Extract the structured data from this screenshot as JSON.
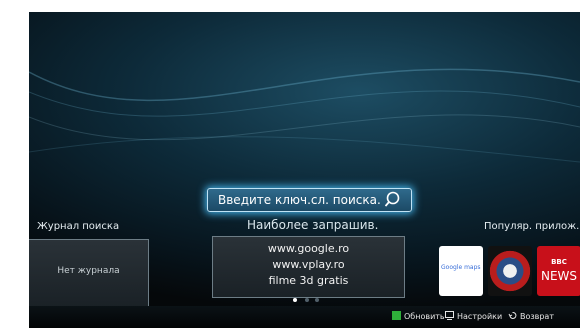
{
  "search": {
    "placeholder": "Введите ключ.сл. поиска."
  },
  "history": {
    "title": "Журнал поиска",
    "empty_text": "Нет журнала"
  },
  "popular_searches": {
    "title": "Наиболее запрашив.",
    "items": [
      "www.google.ro",
      "www.vplay.ro",
      "filme 3d gratis"
    ]
  },
  "popular_apps": {
    "title": "Популяр. прилож.",
    "apps": [
      {
        "name": "Google maps",
        "label": "Google maps"
      },
      {
        "name": "Darts",
        "label": ""
      },
      {
        "name": "BBC News",
        "label_top": "BBC",
        "label_bottom": "NEWS"
      }
    ]
  },
  "pager": {
    "current_page": 1,
    "total_pages": 3
  },
  "bottom_bar": {
    "refresh_label": "Обновить",
    "refresh_key_color": "#2fae3a",
    "settings_label": "Настройки",
    "back_label": "Возврат"
  },
  "colors": {
    "glow": "#3fa9dd",
    "bbc_red": "#c8101a"
  }
}
